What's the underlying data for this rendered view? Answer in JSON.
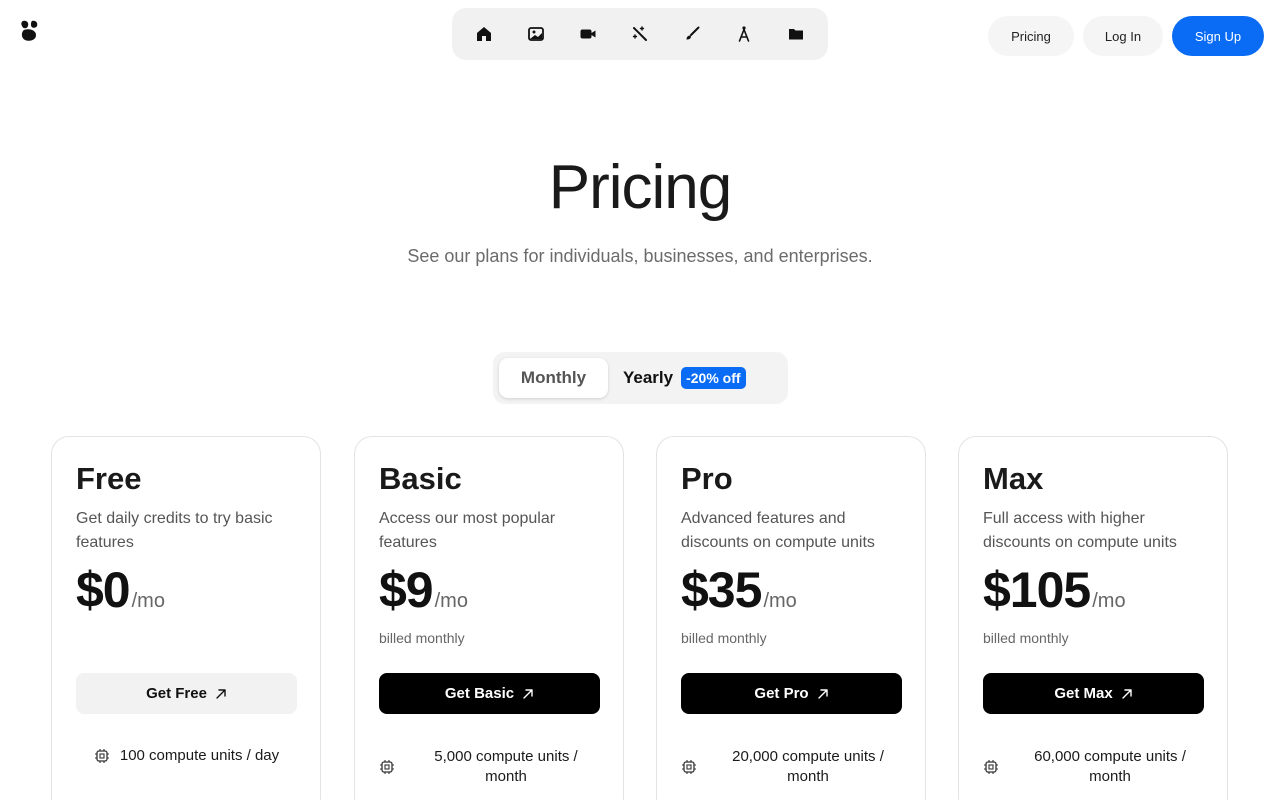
{
  "header": {
    "logo_icon": "logo-icon",
    "toolbar": [
      {
        "name": "home",
        "icon": "home-icon"
      },
      {
        "name": "image",
        "icon": "image-icon"
      },
      {
        "name": "video",
        "icon": "video-camera-icon"
      },
      {
        "name": "enhance",
        "icon": "magic-wand-icon"
      },
      {
        "name": "edit",
        "icon": "brush-icon"
      },
      {
        "name": "draw",
        "icon": "compass-icon"
      },
      {
        "name": "assets",
        "icon": "folder-icon"
      }
    ],
    "nav": {
      "pricing": "Pricing",
      "login": "Log In",
      "signup": "Sign Up"
    }
  },
  "hero": {
    "title": "Pricing",
    "subtitle": "See our plans for individuals, businesses, and enterprises."
  },
  "billing_toggle": {
    "monthly": "Monthly",
    "yearly": "Yearly",
    "discount": "-20% off",
    "selected": "Monthly"
  },
  "plans": [
    {
      "name": "Free",
      "description": "Get daily credits to try basic features",
      "price": "$0",
      "period": "/mo",
      "billing": "",
      "cta": "Get Free",
      "feature": "100 compute units / day"
    },
    {
      "name": "Basic",
      "description": "Access our most popular features",
      "price": "$9",
      "period": "/mo",
      "billing": "billed monthly",
      "cta": "Get Basic",
      "feature": "5,000 compute units / month"
    },
    {
      "name": "Pro",
      "description": "Advanced features and discounts on compute units",
      "price": "$35",
      "period": "/mo",
      "billing": "billed monthly",
      "cta": "Get Pro",
      "feature": "20,000 compute units / month"
    },
    {
      "name": "Max",
      "description": "Full access with higher discounts on compute units",
      "price": "$105",
      "period": "/mo",
      "billing": "billed monthly",
      "cta": "Get Max",
      "feature": "60,000 compute units / month"
    }
  ],
  "colors": {
    "accent": "#0a6cf5",
    "cta_dark": "#000000",
    "cta_light": "#f2f2f2",
    "muted_text": "#6b6b6b"
  }
}
